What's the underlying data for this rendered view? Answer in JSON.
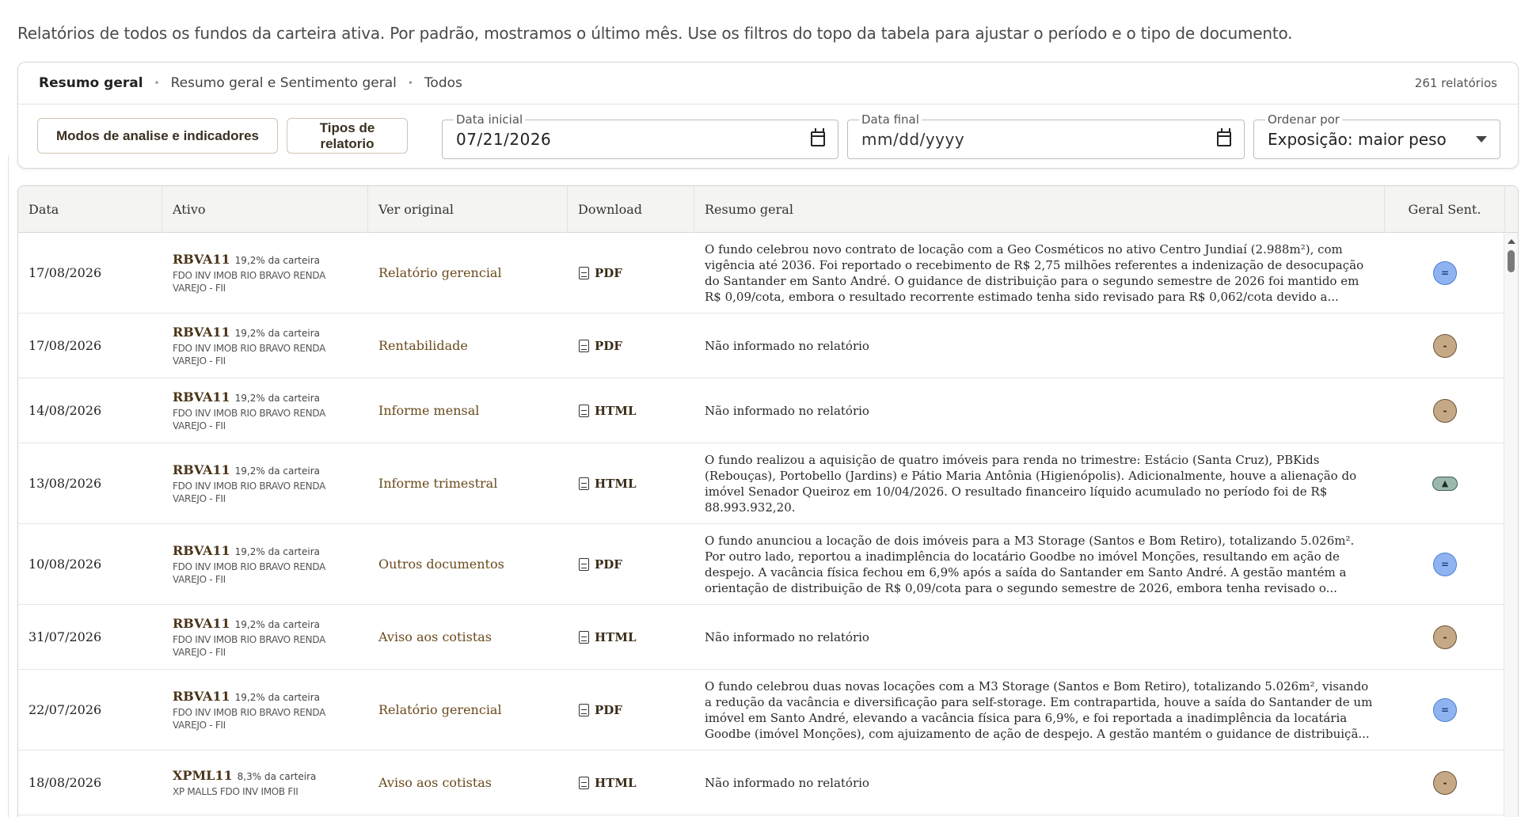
{
  "intro": "Relatórios de todos os fundos da carteira ativa. Por padrão, mostramos o último mês. Use os filtros do topo da tabela para ajustar o período e o tipo de documento.",
  "filters": {
    "breadcrumb": [
      "Resumo geral",
      "Resumo geral e Sentimento geral",
      "Todos"
    ],
    "count": "261 relatórios",
    "modes_button": "Modos de analise e indicadores",
    "types_button": "Tipos de relatorio",
    "start_label": "Data inicial",
    "start_value": "07/21/2026",
    "end_label": "Data final",
    "end_placeholder": "mm/dd/yyyy",
    "order_label": "Ordenar por",
    "order_value": "Exposição: maior peso"
  },
  "table": {
    "columns": [
      "Data",
      "Ativo",
      "Ver original",
      "Download",
      "Resumo geral",
      "Geral Sent."
    ],
    "rows": [
      {
        "date": "17/08/2026",
        "ticker": "RBVA11",
        "weight": "19,2% da carteira",
        "fund": "FDO INV IMOB RIO BRAVO RENDA VAREJO - FII",
        "original": "Relatório gerencial",
        "download": "PDF",
        "summary": [
          "O fundo celebrou novo contrato de locação com a Geo Cosméticos no ativo Centro Jundiaí (2.988m²), com",
          "vigência até 2036. Foi reportado o recebimento de R$ 2,75 milhões referentes a indenização de desocupação",
          "do Santander em Santo André. O guidance de distribuição para o segundo semestre de 2026 foi mantido em",
          "R$ 0,09/cota, embora o resultado recorrente estimado tenha sido revisado para R$ 0,062/cota devido a..."
        ],
        "sentiment": "="
      },
      {
        "date": "17/08/2026",
        "ticker": "RBVA11",
        "weight": "19,2% da carteira",
        "fund": "FDO INV IMOB RIO BRAVO RENDA VAREJO - FII",
        "original": "Rentabilidade",
        "download": "PDF",
        "summary": [
          "Não informado no relatório"
        ],
        "sentiment": "-"
      },
      {
        "date": "14/08/2026",
        "ticker": "RBVA11",
        "weight": "19,2% da carteira",
        "fund": "FDO INV IMOB RIO BRAVO RENDA VAREJO - FII",
        "original": "Informe mensal",
        "download": "HTML",
        "summary": [
          "Não informado no relatório"
        ],
        "sentiment": "-"
      },
      {
        "date": "13/08/2026",
        "ticker": "RBVA11",
        "weight": "19,2% da carteira",
        "fund": "FDO INV IMOB RIO BRAVO RENDA VAREJO - FII",
        "original": "Informe trimestral",
        "download": "HTML",
        "summary": [
          "O fundo realizou a aquisição de quatro imóveis para renda no trimestre: Estácio (Santa Cruz), PBKids",
          "(Rebouças), Portobello (Jardins) e Pátio Maria Antônia (Higienópolis). Adicionalmente, houve a alienação do",
          "imóvel Senador Queiroz em 10/04/2026. O resultado financeiro líquido acumulado no período foi de R$",
          "88.993.932,20."
        ],
        "sentiment": "▲"
      },
      {
        "date": "10/08/2026",
        "ticker": "RBVA11",
        "weight": "19,2% da carteira",
        "fund": "FDO INV IMOB RIO BRAVO RENDA VAREJO - FII",
        "original": "Outros documentos",
        "download": "PDF",
        "summary": [
          "O fundo anunciou a locação de dois imóveis para a M3 Storage (Santos e Bom Retiro), totalizando 5.026m².",
          "Por outro lado, reportou a inadimplência do locatário Goodbe no imóvel Monções, resultando em ação de",
          "despejo. A vacância física fechou em 6,9% após a saída do Santander em Santo André. A gestão mantém a",
          "orientação de distribuição de R$ 0,09/cota para o segundo semestre de 2026, embora tenha revisado o..."
        ],
        "sentiment": "="
      },
      {
        "date": "31/07/2026",
        "ticker": "RBVA11",
        "weight": "19,2% da carteira",
        "fund": "FDO INV IMOB RIO BRAVO RENDA VAREJO - FII",
        "original": "Aviso aos cotistas",
        "download": "HTML",
        "summary": [
          "Não informado no relatório"
        ],
        "sentiment": "-"
      },
      {
        "date": "22/07/2026",
        "ticker": "RBVA11",
        "weight": "19,2% da carteira",
        "fund": "FDO INV IMOB RIO BRAVO RENDA VAREJO - FII",
        "original": "Relatório gerencial",
        "download": "PDF",
        "summary": [
          "O fundo celebrou duas novas locações com a M3 Storage (Santos e Bom Retiro), totalizando 5.026m², visando",
          "a redução da vacância e diversificação para self-storage. Em contrapartida, houve a saída do Santander de um",
          "imóvel em Santo André, elevando a vacância física para 6,9%, e foi reportada a inadimplência da locatária",
          "Goodbe (imóvel Monções), com ajuizamento de ação de despejo. A gestão mantém o guidance de distribuiçã..."
        ],
        "sentiment": "="
      },
      {
        "date": "18/08/2026",
        "ticker": "XPML11",
        "weight": "8,3% da carteira",
        "fund": "XP MALLS FDO INV IMOB FII",
        "original": "Aviso aos cotistas",
        "download": "HTML",
        "summary": [
          "Não informado no relatório"
        ],
        "sentiment": "-"
      }
    ]
  }
}
